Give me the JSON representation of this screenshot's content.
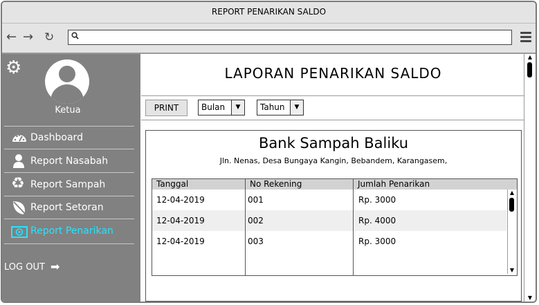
{
  "window": {
    "title": "REPORT PENARIKAN SALDO"
  },
  "browser": {
    "back_icon": "arrow-left-icon",
    "forward_icon": "arrow-right-icon",
    "reload_icon": "reload-icon",
    "search_icon": "search-icon",
    "menu_icon": "hamburger-icon",
    "url_value": ""
  },
  "sidebar": {
    "settings_icon": "gear-icon",
    "role": "Ketua",
    "items": [
      {
        "label": "Dashboard",
        "icon": "dashboard-icon",
        "active": false
      },
      {
        "label": "Report  Nasabah",
        "icon": "user-icon",
        "active": false
      },
      {
        "label": "Report Sampah",
        "icon": "recycle-icon",
        "active": false
      },
      {
        "label": "Report Setoran",
        "icon": "leaf-icon",
        "active": false
      },
      {
        "label": "Report Penarikan",
        "icon": "email-icon",
        "active": true
      }
    ],
    "logout": {
      "label": "LOG OUT",
      "icon": "sign-out-icon"
    }
  },
  "main": {
    "title": "LAPORAN PENARIKAN SALDO",
    "toolbar": {
      "print_label": "PRINT",
      "month_select": "Bulan",
      "year_select": "Tahun"
    },
    "report": {
      "org_name": "Bank Sampah Baliku",
      "address": "Jln. Nenas, Desa Bungaya Kangin, Bebandem, Karangasem,",
      "columns": [
        "Tanggal",
        "No Rekening",
        "Jumlah Penarikan"
      ],
      "rows": [
        [
          "12-04-2019",
          "001",
          "Rp. 3000"
        ],
        [
          "12-04-2019",
          "002",
          "Rp. 4000"
        ],
        [
          "12-04-2019",
          "003",
          "Rp. 3000"
        ]
      ]
    }
  },
  "colors": {
    "sidebar_bg": "#818181",
    "active_menu": "#27e3ff",
    "chrome_bg": "#e4e4e4"
  }
}
